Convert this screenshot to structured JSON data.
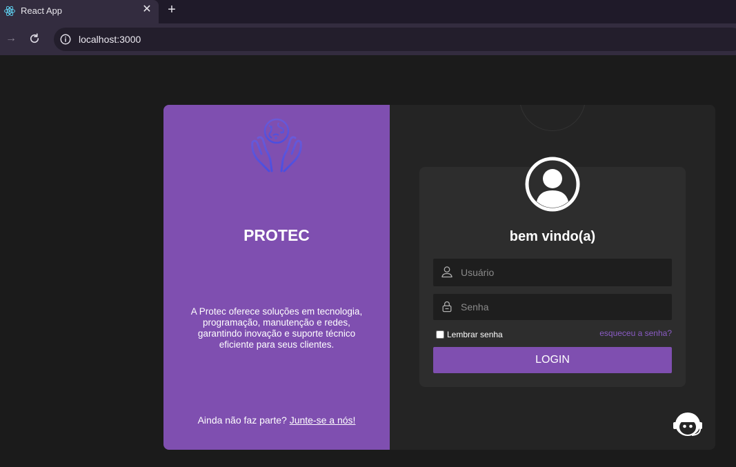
{
  "browser": {
    "tab_title": "React App",
    "tab_close": "✕",
    "new_tab": "+",
    "url": "localhost:3000",
    "back_icon": "arrow-left-icon",
    "forward_icon": "arrow-right-icon",
    "reload_icon": "reload-icon"
  },
  "left": {
    "brand": "PROTEC",
    "description": "A Protec oferece soluções em tecnologia, programação, manutenção e redes, garantindo inovação e suporte técnico eficiente para seus clientes.",
    "join_prefix": "Ainda não faz parte?",
    "join_link": "Junte-se a nós!"
  },
  "login": {
    "title": "bem vindo(a)",
    "user_placeholder": "Usuário",
    "pass_placeholder": "Senha",
    "remember_label": "Lembrar senha",
    "forgot_label": "esqueceu a senha?",
    "button_label": "LOGIN"
  },
  "colors": {
    "accent": "#7f4fb0",
    "background": "#1b1b1b",
    "card": "#242424",
    "box": "#2d2d2d"
  }
}
